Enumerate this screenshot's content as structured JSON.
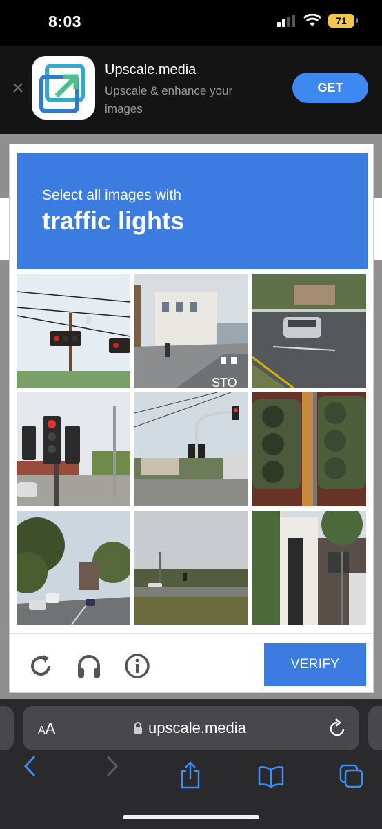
{
  "status_bar": {
    "time": "8:03",
    "battery": "71"
  },
  "app_banner": {
    "name": "Upscale.media",
    "description": "Upscale & enhance your images",
    "cta": "GET"
  },
  "captcha": {
    "instruction": "Select all images with",
    "target": "traffic lights",
    "tiles": [
      "tile-1",
      "tile-2",
      "tile-3",
      "tile-4",
      "tile-5",
      "tile-6",
      "tile-7",
      "tile-8",
      "tile-9"
    ],
    "verify_label": "VERIFY"
  },
  "browser": {
    "text_size_label_small": "A",
    "text_size_label_big": "A",
    "url": "upscale.media"
  },
  "colors": {
    "captcha_blue": "#3c7ce0",
    "get_button": "#3e88f2",
    "safari_blue": "#3e8ef7"
  }
}
